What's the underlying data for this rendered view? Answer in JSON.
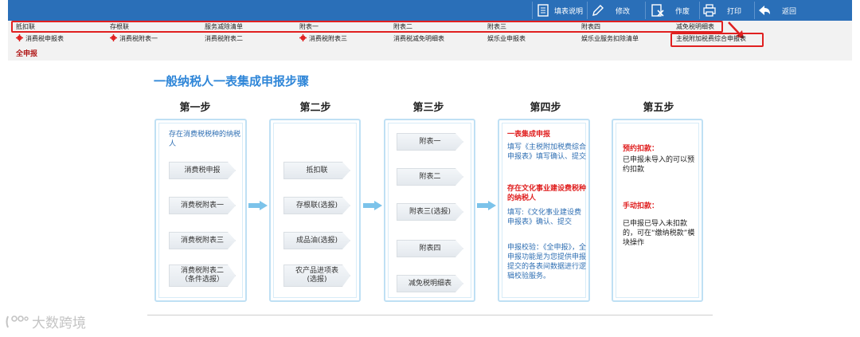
{
  "toolbar": {
    "buttons": [
      {
        "label": "填表说明",
        "icon": "document-icon"
      },
      {
        "label": "修改",
        "icon": "pencil-icon"
      },
      {
        "label": "作废",
        "icon": "void-document-icon"
      },
      {
        "label": "打印",
        "icon": "printer-icon"
      },
      {
        "label": "返回",
        "icon": "back-arrow-icon"
      }
    ]
  },
  "tabs_row1": [
    "抵扣联",
    "存根联",
    "服务减除清单",
    "附表一",
    "附表二",
    "附表三",
    "附表四",
    "减免税明细表"
  ],
  "tabs_row2": [
    "消费税申报表",
    "消费税附表一",
    "消费税附表二",
    "消费税附表三",
    "消费税减免明细表",
    "娱乐业申报表",
    "娱乐业服务扣除清单",
    "主税附加税费综合申报表"
  ],
  "full_declaration": "全申报",
  "main_title": "一般纳税人一表集成申报步骤",
  "steps": [
    "第一步",
    "第二步",
    "第三步",
    "第四步",
    "第五步"
  ],
  "step1": {
    "desc": "存在消费税税种的纳税人",
    "items": [
      "消费税申报",
      "消费税附表一",
      "消费税附表三",
      "消费税附表二\n（条件选报）"
    ]
  },
  "step2": {
    "items": [
      "抵扣联",
      "存根联(选报)",
      "成品油(选报)",
      "农产品进项表\n(选报)"
    ]
  },
  "step3": {
    "items": [
      "附表一",
      "附表二",
      "附表三(选报)",
      "附表四",
      "减免税明细表"
    ]
  },
  "step4": {
    "h1": "一表集成申报",
    "t1": "填写《主税附加税费综合申报表》填写确认、提交",
    "h2": "存在文化事业建设费税种的纳税人",
    "t2": "填写:《文化事业建设费申报表》确认、提交",
    "t3": "申报校验：《全申报》，全申报功能是为您提供申报提交的各表间数据进行逻辑校验服务。"
  },
  "step5": {
    "h1": "预约扣款：",
    "t1": "已申报未导入的可以预约扣款",
    "h2": "手动扣款：",
    "t2": "已申报已导入未扣款的，可在“缴纳税款”模块操作"
  },
  "watermark": "大数跨境",
  "colors": {
    "toolbar": "#2a6fb8",
    "accent_blue": "#2f86d8",
    "highlight_red": "#e02020",
    "panel_border": "#bfe0f4",
    "arrow": "#7cc3ea"
  }
}
